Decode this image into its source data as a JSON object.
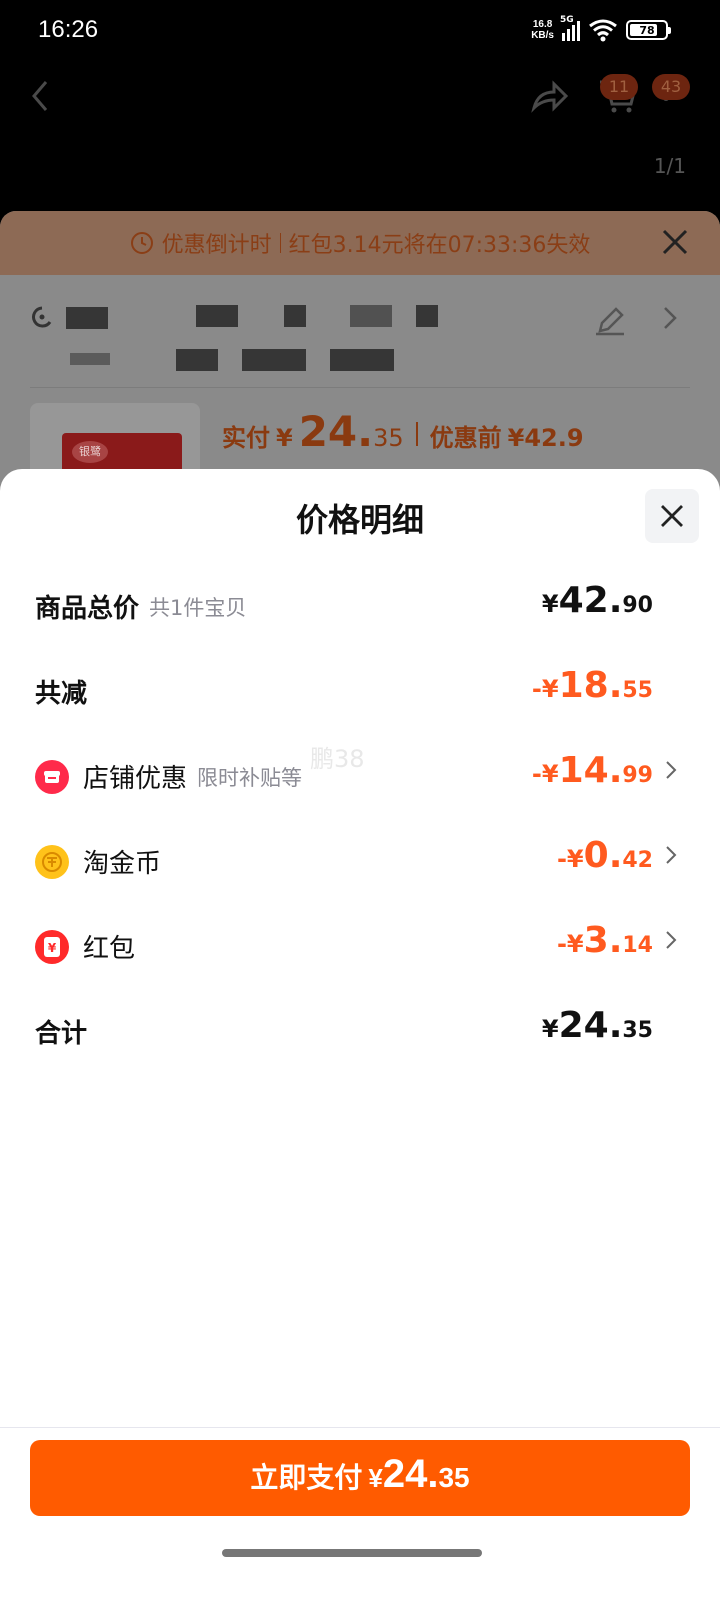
{
  "status_bar": {
    "time": "16:26",
    "net_speed_value": "16.8",
    "net_speed_unit": "KB/s",
    "signal_type": "5G",
    "battery_percent": "78",
    "battery_level": 0.78
  },
  "background": {
    "nav": {
      "cart_badge": "11",
      "more_badge": "43",
      "page_counter": "1/1"
    },
    "countdown": {
      "label": "优惠倒计时",
      "message": "红包3.14元将在07:33:36失效"
    },
    "product": {
      "thumb_brand": "银鹭",
      "paid_label": "实付",
      "paid_yen": "¥",
      "paid_int": "24.",
      "paid_dec": "35",
      "before_label": "优惠前",
      "before_value": "¥42.9"
    }
  },
  "modal": {
    "title": "价格明细",
    "rows": [
      {
        "label": "商品总价",
        "sub": "共1件宝贝",
        "amount_prefix": "¥",
        "amount_int": "42.",
        "amount_dec": "90"
      },
      {
        "label": "共减",
        "amount_prefix": "-¥",
        "amount_int": "18.",
        "amount_dec": "55"
      },
      {
        "label": "店铺优惠",
        "sub": "限时补贴等",
        "icon": "store-icon",
        "amount_prefix": "-¥",
        "amount_int": "14.",
        "amount_dec": "99"
      },
      {
        "label": "淘金币",
        "icon": "coin-icon",
        "amount_prefix": "-¥",
        "amount_int": "0.",
        "amount_dec": "42"
      },
      {
        "label": "红包",
        "icon": "red-packet-icon",
        "amount_prefix": "-¥",
        "amount_int": "3.",
        "amount_dec": "14"
      },
      {
        "label": "合计",
        "amount_prefix": "¥",
        "amount_int": "24.",
        "amount_dec": "35"
      }
    ],
    "watermark": "鹏38"
  },
  "footer": {
    "pay_label": "立即支付",
    "pay_yen": "¥",
    "pay_int": "24.",
    "pay_dec": "35"
  },
  "colors": {
    "accent": "#ff5b00",
    "discount": "#ff5a1f",
    "text": "#111111",
    "muted": "#8b8b94"
  }
}
